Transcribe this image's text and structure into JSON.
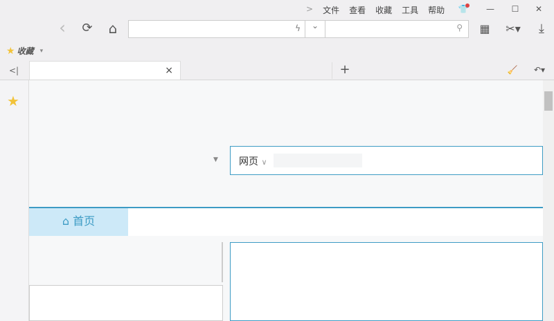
{
  "menu": {
    "chevron": ">",
    "items": [
      "文件",
      "查看",
      "收藏",
      "工具",
      "帮助"
    ]
  },
  "window": {
    "minimize": "—",
    "maximize": "☐",
    "close": "✕"
  },
  "nav": {
    "back": "‹",
    "reload": "⟳",
    "home": "⌂"
  },
  "bookmarks": {
    "label": "收藏",
    "dropdown": "▾"
  },
  "tabs": {
    "collapse": "<|",
    "close": "×",
    "new_tab": "+"
  },
  "page": {
    "search_type": "网页",
    "search_type_chevron": "∨",
    "home_tab": "首页"
  },
  "colors": {
    "accent": "#3c9bc4",
    "home_tab_bg": "#cde9f8"
  }
}
